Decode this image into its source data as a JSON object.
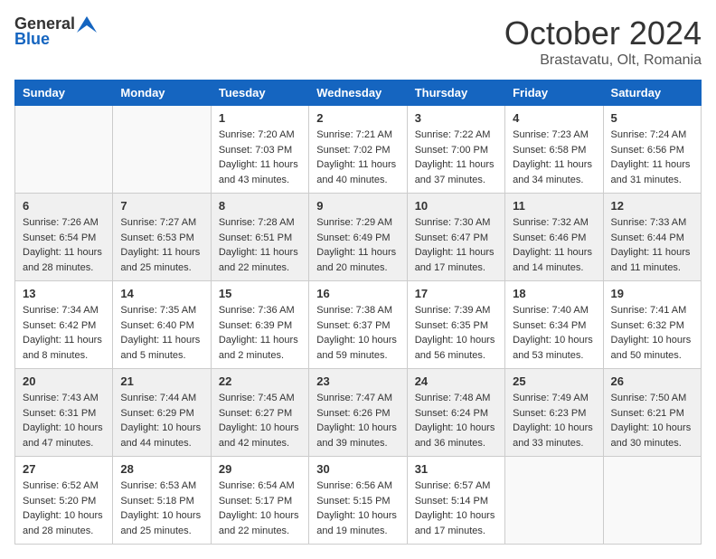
{
  "header": {
    "logo_general": "General",
    "logo_blue": "Blue",
    "title": "October 2024",
    "location": "Brastavatu, Olt, Romania"
  },
  "days_of_week": [
    "Sunday",
    "Monday",
    "Tuesday",
    "Wednesday",
    "Thursday",
    "Friday",
    "Saturday"
  ],
  "weeks": [
    [
      {
        "day": "",
        "info": ""
      },
      {
        "day": "",
        "info": ""
      },
      {
        "day": "1",
        "info": "Sunrise: 7:20 AM\nSunset: 7:03 PM\nDaylight: 11 hours and 43 minutes."
      },
      {
        "day": "2",
        "info": "Sunrise: 7:21 AM\nSunset: 7:02 PM\nDaylight: 11 hours and 40 minutes."
      },
      {
        "day": "3",
        "info": "Sunrise: 7:22 AM\nSunset: 7:00 PM\nDaylight: 11 hours and 37 minutes."
      },
      {
        "day": "4",
        "info": "Sunrise: 7:23 AM\nSunset: 6:58 PM\nDaylight: 11 hours and 34 minutes."
      },
      {
        "day": "5",
        "info": "Sunrise: 7:24 AM\nSunset: 6:56 PM\nDaylight: 11 hours and 31 minutes."
      }
    ],
    [
      {
        "day": "6",
        "info": "Sunrise: 7:26 AM\nSunset: 6:54 PM\nDaylight: 11 hours and 28 minutes."
      },
      {
        "day": "7",
        "info": "Sunrise: 7:27 AM\nSunset: 6:53 PM\nDaylight: 11 hours and 25 minutes."
      },
      {
        "day": "8",
        "info": "Sunrise: 7:28 AM\nSunset: 6:51 PM\nDaylight: 11 hours and 22 minutes."
      },
      {
        "day": "9",
        "info": "Sunrise: 7:29 AM\nSunset: 6:49 PM\nDaylight: 11 hours and 20 minutes."
      },
      {
        "day": "10",
        "info": "Sunrise: 7:30 AM\nSunset: 6:47 PM\nDaylight: 11 hours and 17 minutes."
      },
      {
        "day": "11",
        "info": "Sunrise: 7:32 AM\nSunset: 6:46 PM\nDaylight: 11 hours and 14 minutes."
      },
      {
        "day": "12",
        "info": "Sunrise: 7:33 AM\nSunset: 6:44 PM\nDaylight: 11 hours and 11 minutes."
      }
    ],
    [
      {
        "day": "13",
        "info": "Sunrise: 7:34 AM\nSunset: 6:42 PM\nDaylight: 11 hours and 8 minutes."
      },
      {
        "day": "14",
        "info": "Sunrise: 7:35 AM\nSunset: 6:40 PM\nDaylight: 11 hours and 5 minutes."
      },
      {
        "day": "15",
        "info": "Sunrise: 7:36 AM\nSunset: 6:39 PM\nDaylight: 11 hours and 2 minutes."
      },
      {
        "day": "16",
        "info": "Sunrise: 7:38 AM\nSunset: 6:37 PM\nDaylight: 10 hours and 59 minutes."
      },
      {
        "day": "17",
        "info": "Sunrise: 7:39 AM\nSunset: 6:35 PM\nDaylight: 10 hours and 56 minutes."
      },
      {
        "day": "18",
        "info": "Sunrise: 7:40 AM\nSunset: 6:34 PM\nDaylight: 10 hours and 53 minutes."
      },
      {
        "day": "19",
        "info": "Sunrise: 7:41 AM\nSunset: 6:32 PM\nDaylight: 10 hours and 50 minutes."
      }
    ],
    [
      {
        "day": "20",
        "info": "Sunrise: 7:43 AM\nSunset: 6:31 PM\nDaylight: 10 hours and 47 minutes."
      },
      {
        "day": "21",
        "info": "Sunrise: 7:44 AM\nSunset: 6:29 PM\nDaylight: 10 hours and 44 minutes."
      },
      {
        "day": "22",
        "info": "Sunrise: 7:45 AM\nSunset: 6:27 PM\nDaylight: 10 hours and 42 minutes."
      },
      {
        "day": "23",
        "info": "Sunrise: 7:47 AM\nSunset: 6:26 PM\nDaylight: 10 hours and 39 minutes."
      },
      {
        "day": "24",
        "info": "Sunrise: 7:48 AM\nSunset: 6:24 PM\nDaylight: 10 hours and 36 minutes."
      },
      {
        "day": "25",
        "info": "Sunrise: 7:49 AM\nSunset: 6:23 PM\nDaylight: 10 hours and 33 minutes."
      },
      {
        "day": "26",
        "info": "Sunrise: 7:50 AM\nSunset: 6:21 PM\nDaylight: 10 hours and 30 minutes."
      }
    ],
    [
      {
        "day": "27",
        "info": "Sunrise: 6:52 AM\nSunset: 5:20 PM\nDaylight: 10 hours and 28 minutes."
      },
      {
        "day": "28",
        "info": "Sunrise: 6:53 AM\nSunset: 5:18 PM\nDaylight: 10 hours and 25 minutes."
      },
      {
        "day": "29",
        "info": "Sunrise: 6:54 AM\nSunset: 5:17 PM\nDaylight: 10 hours and 22 minutes."
      },
      {
        "day": "30",
        "info": "Sunrise: 6:56 AM\nSunset: 5:15 PM\nDaylight: 10 hours and 19 minutes."
      },
      {
        "day": "31",
        "info": "Sunrise: 6:57 AM\nSunset: 5:14 PM\nDaylight: 10 hours and 17 minutes."
      },
      {
        "day": "",
        "info": ""
      },
      {
        "day": "",
        "info": ""
      }
    ]
  ]
}
